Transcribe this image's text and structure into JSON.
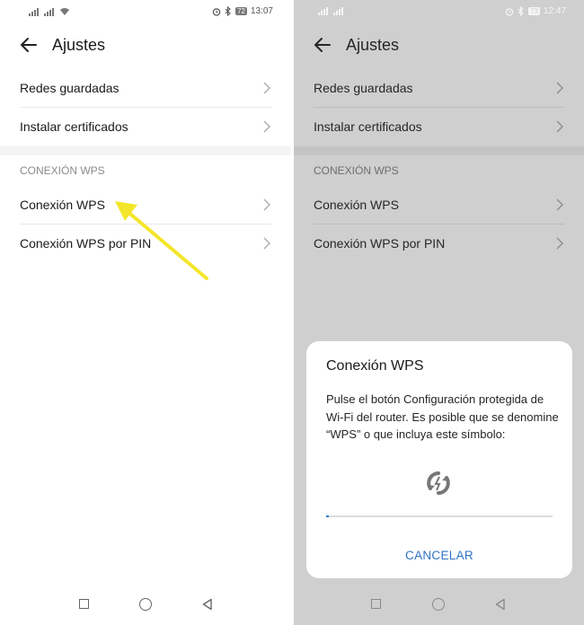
{
  "left": {
    "status": {
      "battery": "72",
      "time": "13:07"
    },
    "appbar": {
      "title": "Ajustes"
    },
    "rows": {
      "saved_networks": "Redes guardadas",
      "install_certificates": "Instalar certificados"
    },
    "section_label": "CONEXIÓN WPS",
    "wps_rows": {
      "wps": "Conexión WPS",
      "wps_pin": "Conexión WPS por PIN"
    }
  },
  "right": {
    "status": {
      "battery": "73",
      "time": "12:47"
    },
    "appbar": {
      "title": "Ajustes"
    },
    "rows": {
      "saved_networks": "Redes guardadas",
      "install_certificates": "Instalar certificados"
    },
    "section_label": "CONEXIÓN WPS",
    "wps_rows": {
      "wps": "Conexión WPS",
      "wps_pin": "Conexión WPS por PIN"
    },
    "dialog": {
      "title": "Conexión WPS",
      "body": "Pulse el botón Configuración protegida de Wi-Fi del router. Es posible que se denomine “WPS” o que incluya este símbolo:",
      "progress_fraction": 0.01,
      "cancel_label": "CANCELAR"
    }
  },
  "annotation": {
    "arrow_color": "#f3e62a"
  },
  "colors": {
    "accent": "#2e72c2",
    "dim_background": "#cfcfcf"
  }
}
